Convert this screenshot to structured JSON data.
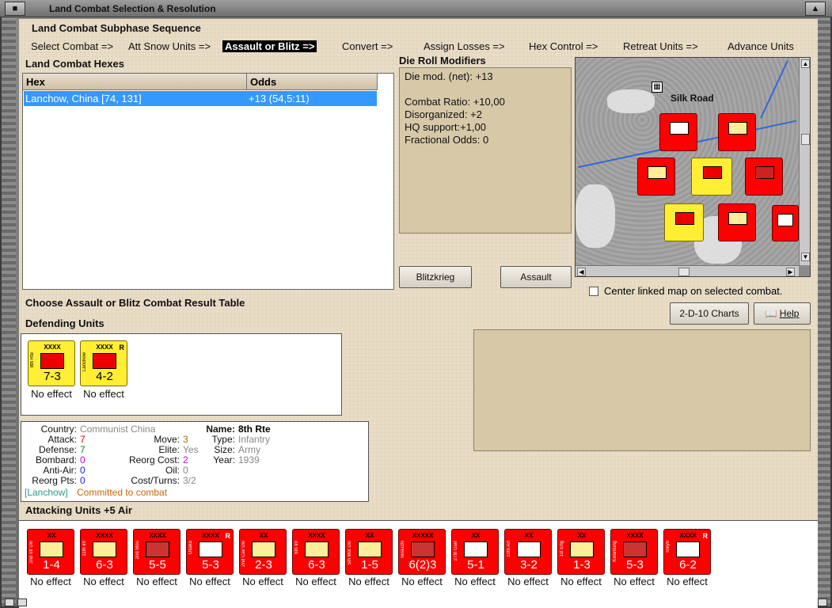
{
  "window": {
    "title": "Land Combat Selection & Resolution"
  },
  "subphase": {
    "heading": "Land Combat Subphase Sequence",
    "steps": [
      "Select Combat =>",
      "Att Snow Units =>",
      "Assault or Blitz =>",
      "Convert =>",
      "Assign Losses =>",
      "Hex Control =>",
      "Retreat Units =>",
      "Advance Units"
    ]
  },
  "combat_hexes": {
    "heading": "Land Combat Hexes",
    "columns": [
      "Hex",
      "Odds"
    ],
    "rows": [
      {
        "hex": "Lanchow, China [74, 131]",
        "odds": "+13 (54,5:11)"
      }
    ]
  },
  "modifiers": {
    "heading": "Die Roll Modifiers",
    "lines": [
      "Die mod. (net): +13",
      "",
      "Combat Ratio: +10,00",
      "Disorganized: +2",
      "HQ support:+1,00",
      "Fractional Odds: 0"
    ]
  },
  "buttons": {
    "blitzkrieg": "Blitzkrieg",
    "assault": "Assault",
    "charts": "2-D-10 Charts",
    "help": "Help"
  },
  "map": {
    "label": "Silk Road",
    "center_linked": "Center linked map on selected combat."
  },
  "choose_label": "Choose Assault or Blitz Combat Result Table",
  "defending": {
    "heading": "Defending Units",
    "units": [
      {
        "name": "8th Rte",
        "size": "XXXX",
        "values": "7-3",
        "result": "No effect",
        "reserve": ""
      },
      {
        "name": "Lanchow",
        "size": "XXXX",
        "values": "4-2",
        "result": "No effect",
        "reserve": "R"
      }
    ]
  },
  "unit_info": {
    "country_k": "Country:",
    "country_v": "Communist China",
    "attack_k": "Attack:",
    "attack_v": "7",
    "defense_k": "Defense:",
    "defense_v": "7",
    "bombard_k": "Bombard:",
    "bombard_v": "0",
    "antiair_k": "Anti-Air:",
    "antiair_v": "0",
    "reorg_k": "Reorg Pts:",
    "reorg_v": "0",
    "move_k": "Move:",
    "move_v": "3",
    "elite_k": "Elite:",
    "elite_v": "Yes",
    "reorgcost_k": "Reorg Cost:",
    "reorgcost_v": "2",
    "oil_k": "Oil:",
    "oil_v": "0",
    "cost_k": "Cost/Turns:",
    "cost_v": "3/2",
    "name_k": "Name:",
    "name_v": "8th Rte",
    "type_k": "Type:",
    "type_v": "Infantry",
    "size_k": "Size:",
    "size_v": "Army",
    "year_k": "Year:",
    "year_v": "1939",
    "status_loc": "[Lanchow]",
    "status_text": " Committed to combat"
  },
  "attacking": {
    "heading": "Attacking Units +5 Air",
    "units": [
      {
        "name": "2nd Inf Div",
        "size": "XX",
        "values": "1-4",
        "result": "No effect",
        "reserve": "",
        "kind": "inf"
      },
      {
        "name": "11th Inf",
        "size": "XXXX",
        "values": "6-3",
        "result": "No effect",
        "reserve": "",
        "kind": "inf"
      },
      {
        "name": "2nd Mou",
        "size": "XXXX",
        "values": "5-5",
        "result": "No effect",
        "reserve": "",
        "kind": "mtn"
      },
      {
        "name": "Osaka",
        "size": "XXXX",
        "values": "5-3",
        "result": "No effect",
        "reserve": "R",
        "kind": "mech"
      },
      {
        "name": "2nd Cav Div",
        "size": "XX",
        "values": "2-3",
        "result": "No effect",
        "reserve": "",
        "kind": "cav"
      },
      {
        "name": "6th Inf",
        "size": "XXXX",
        "values": "6-3",
        "result": "No effect",
        "reserve": "",
        "kind": "inf"
      },
      {
        "name": "5th Mot Div",
        "size": "XX",
        "values": "1-5",
        "result": "No effect",
        "reserve": "",
        "kind": "mot"
      },
      {
        "name": "Terauchi",
        "size": "XXXXX",
        "values": "6(2)3",
        "result": "No effect",
        "reserve": "",
        "kind": "hq"
      },
      {
        "name": "27th Garr",
        "size": "XX",
        "values": "5-1",
        "result": "No effect",
        "reserve": "",
        "kind": "garr"
      },
      {
        "name": "10th Art",
        "size": "XX",
        "values": "3-2",
        "result": "No effect",
        "reserve": "",
        "kind": "art"
      },
      {
        "name": "1st Eng",
        "size": "XX",
        "values": "1-3",
        "result": "No effect",
        "reserve": "",
        "kind": "eng"
      },
      {
        "name": "Kwantung",
        "size": "XXXX",
        "values": "5-3",
        "result": "No effect",
        "reserve": "",
        "kind": "mech"
      },
      {
        "name": "Tokyo",
        "size": "XXXX",
        "values": "6-2",
        "result": "No effect",
        "reserve": "R",
        "kind": "mech"
      }
    ]
  },
  "colors": {
    "axis_red": "#ff0000",
    "china_yellow": "#ffee33",
    "selection_blue": "#3399ff",
    "panel_tan": "#e8dcc6"
  }
}
